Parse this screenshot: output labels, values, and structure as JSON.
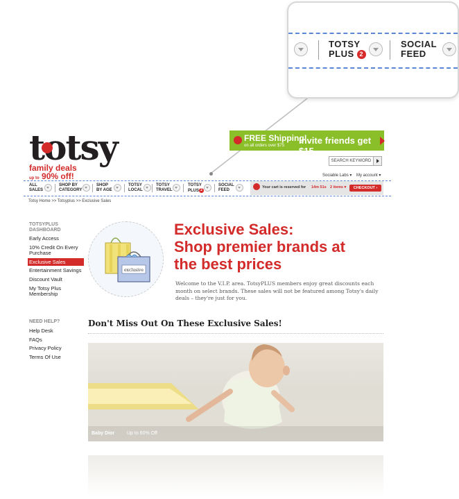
{
  "zoom": {
    "items": [
      {
        "line1": "TOTSY",
        "line2": "PLUS",
        "badge": "2"
      },
      {
        "line1": "SOCIAL",
        "line2": "FEED"
      }
    ]
  },
  "header": {
    "logo": "totsy",
    "tagline_1": "family deals",
    "tagline_2": "up to",
    "tagline_3": "90% off!",
    "promo": {
      "free": "FREE Shipping!",
      "free_sub": "on all orders over $75",
      "invite": "Invite friends get $15"
    },
    "search_placeholder": "SEARCH KEYWORD",
    "sociable": "Sociable Labs ▾",
    "my_account": "My account ▾"
  },
  "nav": {
    "items": [
      {
        "l1": "ALL",
        "l2": "SALES"
      },
      {
        "l1": "SHOP BY",
        "l2": "CATEGORY"
      },
      {
        "l1": "SHOP",
        "l2": "BY AGE"
      },
      {
        "l1": "TOTSY",
        "l2": "LOCAL"
      },
      {
        "l1": "TOTSY",
        "l2": "TRAVEL"
      },
      {
        "l1": "TOTSY",
        "l2": "PLUS",
        "badge": "2"
      },
      {
        "l1": "SOCIAL",
        "l2": "FEED"
      }
    ],
    "cart": {
      "text": "Your cart is reserved for",
      "time": "14m 51s",
      "items": "2 items ▾",
      "checkout": "CHECKOUT ›"
    }
  },
  "breadcrumb": "Totsy Home >> Totsyplus >> Exclusive Sales",
  "sidebar": {
    "dashboard_title": "TOTSYPLUS DASHBOARD",
    "links": [
      "Early Access",
      "10% Credit On Every Purchase",
      "Exclusive Sales",
      "Entertainment Savings",
      "Discount Vault",
      "My Totsy Plus Membership"
    ],
    "active_index": 2,
    "help_title": "NEED HELP?",
    "help_links": [
      "Help Desk",
      "FAQs",
      "Privacy Policy",
      "Terms Of Use"
    ]
  },
  "main": {
    "hero_bag_label": "exclusive",
    "hero_title_1": "Exclusive Sales:",
    "hero_title_2": "Shop premier brands at",
    "hero_title_3": "the best prices",
    "hero_desc": "Welcome to the V.I.P. area. TotsyPLUS members enjoy great discounts each month on select brands.  These sales will not be featured among Totsy's daily deals – they're just for you.",
    "section_title": "Don't Miss Out On These Exclusive Sales!",
    "banner": {
      "brand": "Baby Dior",
      "discount": "Up to 60% Off"
    }
  },
  "colors": {
    "brand_red": "#d32a2a",
    "promo_green": "#8bbf29",
    "dash_blue": "#5b86d8"
  }
}
